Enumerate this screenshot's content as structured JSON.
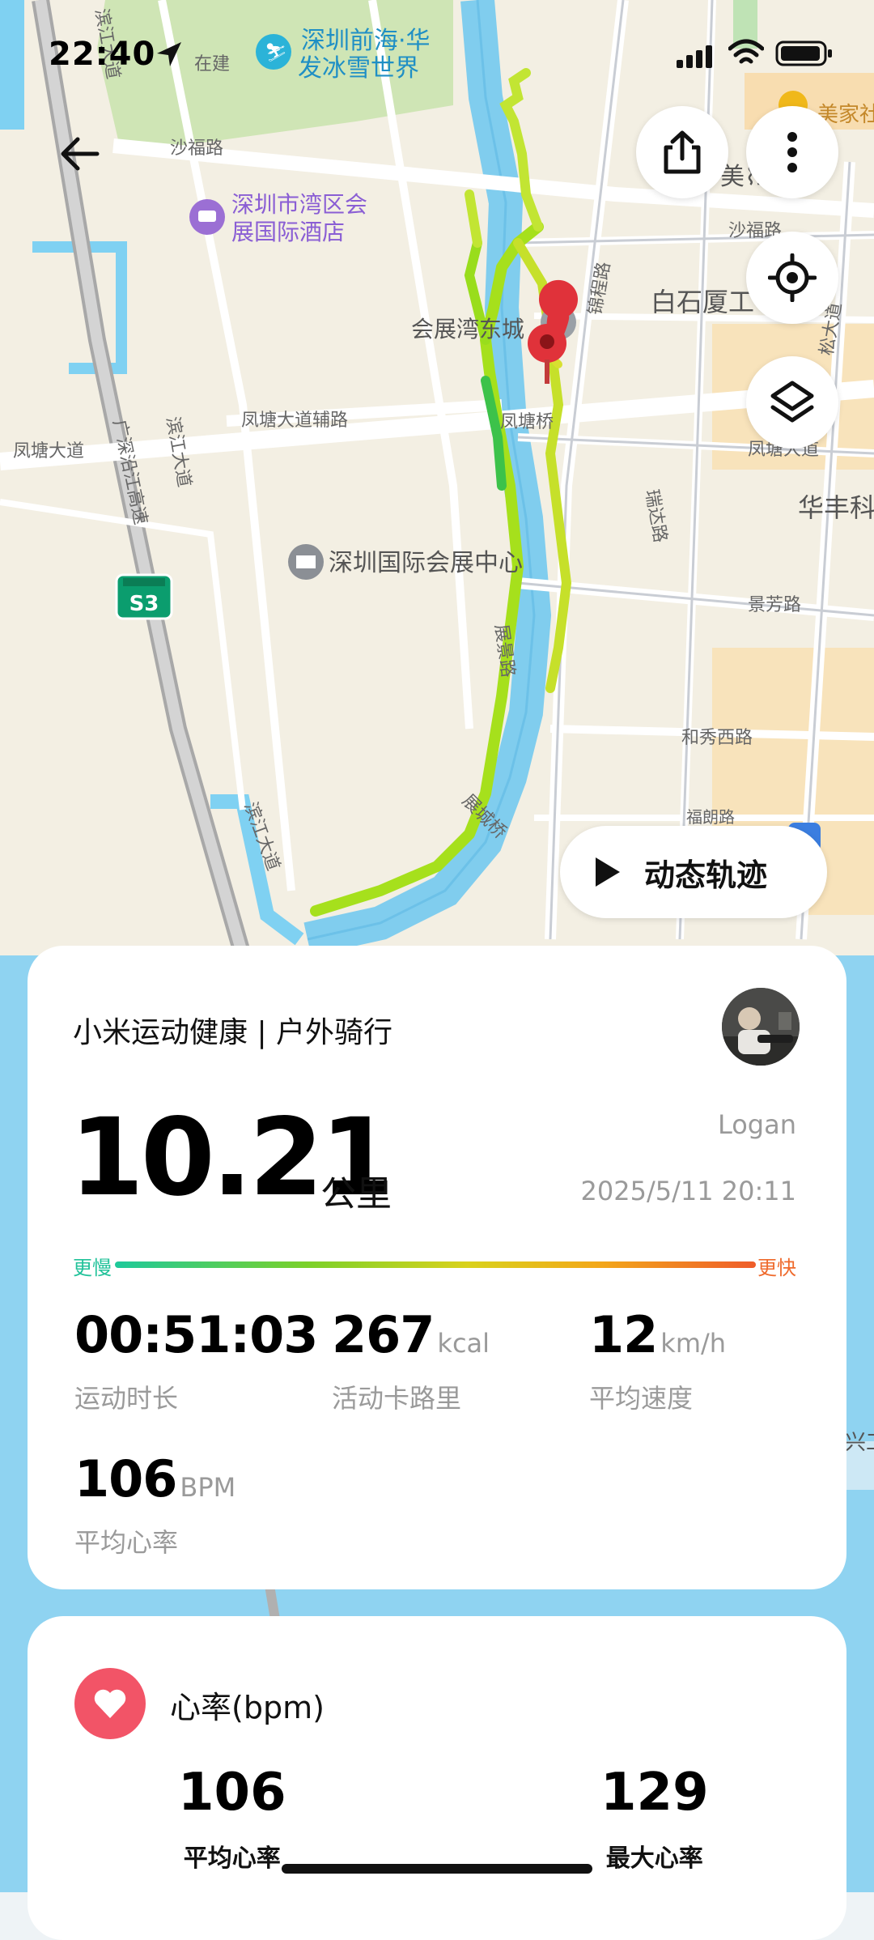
{
  "status_bar": {
    "time": "22:40"
  },
  "map": {
    "labels": {
      "l1": "深圳前海·华",
      "l2": "发冰雪世界",
      "l3": "在建",
      "l4": "滨江大道",
      "l5": "沙福路",
      "l6": "深圳市湾区会",
      "l7": "展国际酒店",
      "l8": "美家社",
      "l9": "美⌇工",
      "l10": "沙福路",
      "l11": "白石厦工",
      "l12": "会展湾东城",
      "l13": "锦程路",
      "l14": "凤塘大道辅路",
      "l15": "凤塘桥",
      "l16": "凤塘大道",
      "l17": "凤塘大道",
      "l18": "广深沿江高速",
      "l19": "滨江大道",
      "l20": "深圳国际会展中心",
      "l21": "瑞达路",
      "l22": "华丰科",
      "l23": "景芳路",
      "l24": "展景路",
      "l25": "和秀西路",
      "l26": "福朗路",
      "l27": "滨江大道",
      "l28": "展城桥",
      "l29": "松大道",
      "l30": "S3",
      "l31": "兴工"
    },
    "play_button_label": "动态轨迹"
  },
  "summary": {
    "brand": "小米运动健康 | 户外骑行",
    "distance": "10.21",
    "distance_unit": "公里",
    "user": "Logan",
    "datetime": "2025/5/11 20:11",
    "pace_slow": "更慢",
    "pace_fast": "更快",
    "stats": [
      {
        "value": "00:51:03",
        "unit": "",
        "label": "运动时长"
      },
      {
        "value": "267",
        "unit": "kcal",
        "label": "活动卡路里"
      },
      {
        "value": "12",
        "unit": "km/h",
        "label": "平均速度"
      },
      {
        "value": "106",
        "unit": "BPM",
        "label": "平均心率"
      }
    ]
  },
  "heart_rate": {
    "title": "心率(bpm)",
    "avg_value": "106",
    "avg_label": "平均心率",
    "max_value": "129",
    "max_label": "最大心率"
  },
  "colors": {
    "route": "#a6e01c",
    "pin": "#e0323a",
    "heart": "#f25467"
  }
}
